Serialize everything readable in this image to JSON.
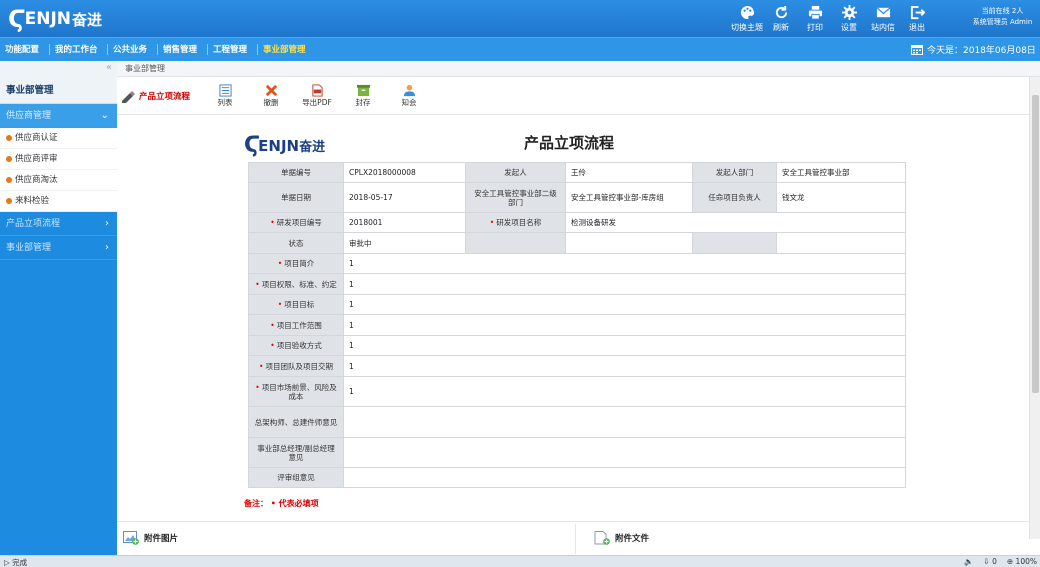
{
  "header": {
    "logo_mark": "Ϛ",
    "logo_word": "ENJN",
    "logo_cn": "奋进",
    "tools": [
      {
        "label": "切换主题",
        "icon": "palette-icon"
      },
      {
        "label": "刷新",
        "icon": "refresh-icon"
      },
      {
        "label": "打印",
        "icon": "print-icon"
      },
      {
        "label": "设置",
        "icon": "gear-icon"
      },
      {
        "label": "站内信",
        "icon": "mail-icon"
      },
      {
        "label": "退出",
        "icon": "logout-icon"
      }
    ],
    "online_count": "当前在线 2人",
    "user": "系统管理员 Admin"
  },
  "navbar": {
    "items": [
      "功能配置",
      "我的工作台",
      "公共业务",
      "销售管理",
      "工程管理",
      "事业部管理"
    ],
    "active_index": 5,
    "date": "今天是：2018年06月08日"
  },
  "sidebar": {
    "title": "事业部管理",
    "groups": [
      {
        "label": "供应商管理",
        "expanded": true
      },
      {
        "label": "产品立项流程",
        "expanded": false
      },
      {
        "label": "事业部管理",
        "expanded": false
      }
    ],
    "subitems": [
      "供应商认证",
      "供应商评审",
      "供应商淘汰",
      "来料检验"
    ]
  },
  "content": {
    "breadcrumb": "事业部管理",
    "page_label": "产品立项流程",
    "toolbar": [
      {
        "label": "列表",
        "icon": "list-icon"
      },
      {
        "label": "撤删",
        "icon": "delete-icon"
      },
      {
        "label": "导出PDF",
        "icon": "pdf-icon"
      },
      {
        "label": "封存",
        "icon": "archive-icon"
      },
      {
        "label": "知会",
        "icon": "notify-icon"
      }
    ]
  },
  "form": {
    "title": "产品立项流程",
    "fields": {
      "doc_no_label": "单据编号",
      "doc_no": "CPLX2018000008",
      "initiator_label": "发起人",
      "initiator": "王伶",
      "dept_label": "发起人部门",
      "dept": "安全工具管控事业部",
      "date_label": "单据日期",
      "date": "2018-05-17",
      "secondary_dept_label": "安全工具管控事业部二级部门",
      "secondary_dept": "安全工具管控事业部-库房组",
      "leader_label": "任命项目负责人",
      "leader": "钱文龙",
      "rd_no_label": "研发项目编号",
      "rd_no": "2018001",
      "rd_name_label": "研发项目名称",
      "rd_name": "检测设备研发",
      "status_label": "状态",
      "status": "审批中"
    },
    "rows": [
      {
        "label": "项目简介",
        "value": "1",
        "required": true
      },
      {
        "label": "项目权限、标准、约定",
        "value": "1",
        "required": true
      },
      {
        "label": "项目目标",
        "value": "1",
        "required": true
      },
      {
        "label": "项目工作范围",
        "value": "1",
        "required": true
      },
      {
        "label": "项目验收方式",
        "value": "1",
        "required": true
      },
      {
        "label": "项目团队及项目交期",
        "value": "1",
        "required": true
      },
      {
        "label": "项目市场前景、风险及成本",
        "value": "1",
        "required": true
      },
      {
        "label": "总架构师、总建件师意见",
        "value": "",
        "required": false
      },
      {
        "label": "事业部总经理/副总经理意见",
        "value": "",
        "required": false
      },
      {
        "label": "评审组意见",
        "value": "",
        "required": false
      }
    ],
    "note": "备注：  • 代表必填项"
  },
  "attachments": {
    "images_label": "附件图片",
    "files_label": "附件文件"
  },
  "statusbar": {
    "left": "完成",
    "items": [
      "0",
      "100%"
    ]
  }
}
